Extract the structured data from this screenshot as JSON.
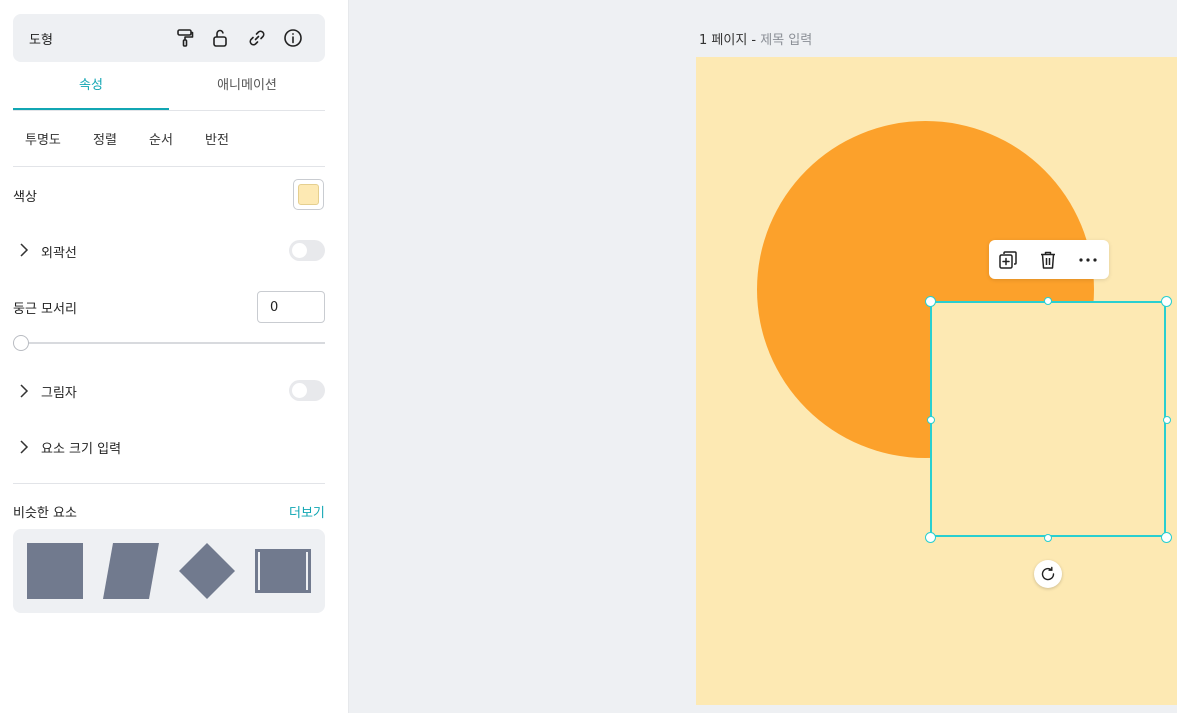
{
  "panel": {
    "title": "도형",
    "header_icons": [
      "paint-roller-icon",
      "unlock-icon",
      "link-icon",
      "info-icon"
    ],
    "tabs": [
      {
        "label": "속성",
        "active": true
      },
      {
        "label": "애니메이션",
        "active": false
      }
    ],
    "subtabs": [
      "투명도",
      "정렬",
      "순서",
      "반전"
    ],
    "color": {
      "label": "색상",
      "value": "#fde9b3"
    },
    "outline": {
      "label": "외곽선",
      "enabled": false
    },
    "corner_radius": {
      "label": "둥근 모서리",
      "value": "0",
      "slider_fraction": 0
    },
    "shadow": {
      "label": "그림자",
      "enabled": false
    },
    "size_input": {
      "label": "요소 크기 입력"
    },
    "similar": {
      "label": "비슷한 요소",
      "more_label": "더보기",
      "shapes": [
        "square-shape",
        "parallelogram-shape",
        "diamond-shape",
        "film-strip-shape"
      ],
      "shape_color": "#717a8e"
    }
  },
  "canvas": {
    "page_number": "1 페이지 -",
    "page_title_placeholder": "제목 입력",
    "page_color": "#fde9b3",
    "circle_color": "#fca12b",
    "square_color": "#fde9b3",
    "selection_color": "#29cfd0",
    "toolbar": [
      "duplicate-icon",
      "trash-icon",
      "more-icon"
    ]
  },
  "accent": "#11a6b3"
}
